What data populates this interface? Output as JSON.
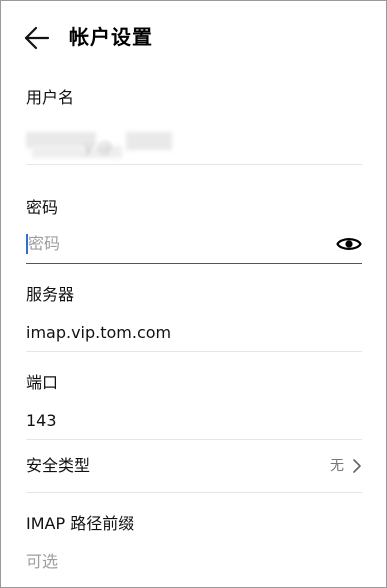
{
  "header": {
    "title": "帐户设置",
    "back_icon": "arrow-left-icon"
  },
  "username": {
    "label": "用户名",
    "value_visible_fragment": "y @"
  },
  "password": {
    "label": "密码",
    "placeholder": "密码",
    "toggle_icon": "eye-icon"
  },
  "server": {
    "label": "服务器",
    "value": "imap.vip.tom.com"
  },
  "port": {
    "label": "端口",
    "value": "143"
  },
  "security": {
    "label": "安全类型",
    "value": "无",
    "chevron_icon": "chevron-right-icon"
  },
  "imap_prefix": {
    "label": "IMAP 路径前缀",
    "placeholder": "可选"
  },
  "colors": {
    "cursor": "#2f6fd6",
    "divider": "#e6e6e6",
    "placeholder": "#9e9e9e"
  }
}
